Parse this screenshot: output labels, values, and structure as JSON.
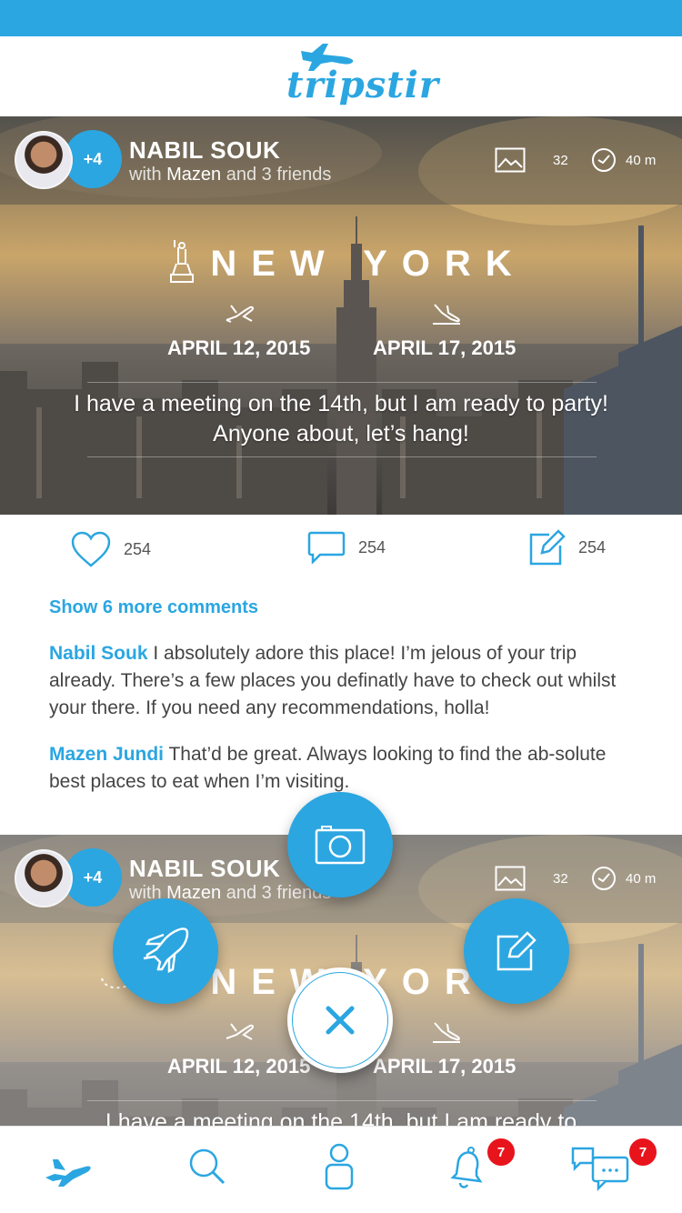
{
  "app": {
    "name": "tripstir"
  },
  "colors": {
    "accent": "#2ba6e1",
    "badge": "#e8141c"
  },
  "posts": [
    {
      "user": {
        "name": "NABIL SOUK",
        "with_prefix": "with",
        "with_friend": "Mazen",
        "with_suffix": "and 3 friends",
        "extra_count": "+4"
      },
      "stats": {
        "photos": "32",
        "time": "40 m"
      },
      "city": "NEW YORK",
      "departure": "APRIL 12, 2015",
      "arrival": "APRIL 17, 2015",
      "message": "I have a meeting on the 14th, but I am ready to party! Anyone about, let’s hang!"
    },
    {
      "user": {
        "name": "NABIL SOUK",
        "with_prefix": "with",
        "with_friend": "Mazen",
        "with_suffix": "and 3 friends",
        "extra_count": "+4"
      },
      "stats": {
        "photos": "32",
        "time": "40 m"
      },
      "city": "NEW YORK",
      "departure": "APRIL 12, 2015",
      "arrival": "APRIL 17, 2015",
      "message": "I have a meeting on the 14th, but I am ready to"
    }
  ],
  "actions": {
    "likes": "254",
    "comments": "254",
    "edits": "254"
  },
  "comments": {
    "show_more": "Show 6 more comments",
    "items": [
      {
        "author": "Nabil Souk",
        "text": "I absolutely adore this place! I’m jelous of your trip already. There’s a few places you definatly have to check out whilst your there. If you need any recommendations, holla!"
      },
      {
        "author": "Mazen Jundi",
        "text": "That’d be great. Always looking to find the ab-solute best places to eat when I’m visiting."
      }
    ]
  },
  "fab_menu": {
    "icons": [
      "camera-icon",
      "plane-icon",
      "edit-icon",
      "close-icon"
    ]
  },
  "nav": {
    "items": [
      "home",
      "search",
      "profile",
      "notifications",
      "messages"
    ],
    "notification_badge": "7",
    "message_badge": "7"
  }
}
